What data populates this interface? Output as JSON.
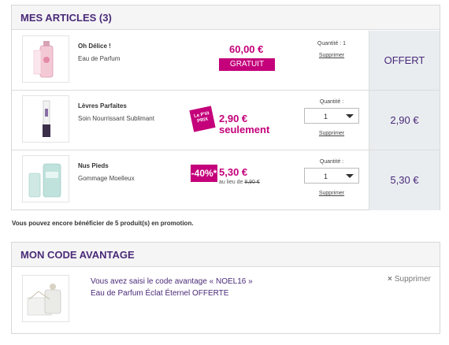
{
  "cart": {
    "title": "MES ARTICLES (3)",
    "items": [
      {
        "name": "Oh Délice !",
        "description": "Eau de Parfum",
        "price": "60,00 €",
        "price_tag": "GRATUIT",
        "quantity_text": "Quantité : 1",
        "remove_label": "Supprimer",
        "total": "OFFERT"
      },
      {
        "name": "Lèvres Parfaites",
        "description": "Soin Nourrissant Sublimant",
        "badge": "Le P'tit PRIX",
        "price": "2,90 €",
        "price_suffix": "seulement",
        "quantity_label": "Quantité :",
        "quantity_value": "1",
        "remove_label": "Supprimer",
        "total": "2,90 €"
      },
      {
        "name": "Nus Pieds",
        "description": "Gommage Moelleux",
        "badge": "-40%*",
        "price": "5,30 €",
        "old_price_prefix": "au lieu de",
        "old_price": "8,90 €",
        "quantity_label": "Quantité :",
        "quantity_value": "1",
        "remove_label": "Supprimer",
        "total": "5,30 €"
      }
    ]
  },
  "promo_note": "Vous pouvez encore bénéficier de 5 produit(s) en promotion.",
  "code_panel": {
    "title": "MON CODE AVANTAGE",
    "line1": "Vous avez saisi le code avantage « NOEL16 »",
    "line2": "Eau de Parfum Éclat Éternel OFFERTE",
    "remove_icon": "×",
    "remove_label": "Supprimer"
  },
  "colors": {
    "accent_purple": "#4a2a78",
    "accent_pink": "#c4007a",
    "total_bg": "#e9edf0"
  }
}
